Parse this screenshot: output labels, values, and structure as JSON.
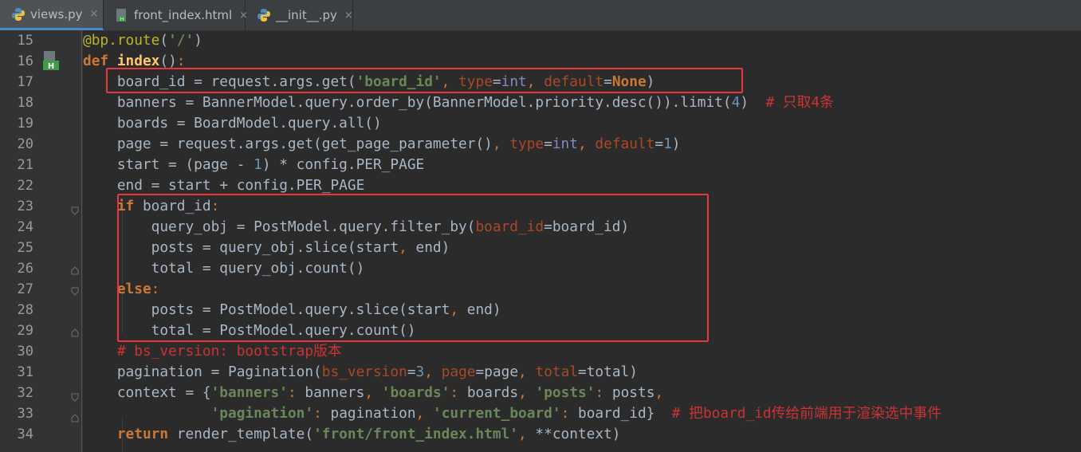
{
  "tabs": [
    {
      "label": "views.py",
      "icon": "python-file-icon",
      "active": true
    },
    {
      "label": "front_index.html",
      "icon": "html-file-icon",
      "active": false
    },
    {
      "label": "__init__.py",
      "icon": "python-file-icon",
      "active": false
    }
  ],
  "tab_close_glyph": "×",
  "highlight_color": "#e8363b",
  "line_numbers": [
    "15",
    "16",
    "17",
    "18",
    "19",
    "20",
    "21",
    "22",
    "23",
    "24",
    "25",
    "26",
    "27",
    "28",
    "29",
    "30",
    "31",
    "32",
    "33",
    "34"
  ],
  "code_lines": [
    "@bp.route('/')",
    "def index():",
    "    board_id = request.args.get('board_id', type=int, default=None)",
    "    banners = BannerModel.query.order_by(BannerModel.priority.desc()).limit(4)  # 只取4条",
    "    boards = BoardModel.query.all()",
    "    page = request.args.get(get_page_parameter(), type=int, default=1)",
    "    start = (page - 1) * config.PER_PAGE",
    "    end = start + config.PER_PAGE",
    "    if board_id:",
    "        query_obj = PostModel.query.filter_by(board_id=board_id)",
    "        posts = query_obj.slice(start, end)",
    "        total = query_obj.count()",
    "    else:",
    "        posts = PostModel.query.slice(start, end)",
    "        total = PostModel.query.count()",
    "    # bs_version: bootstrap版本",
    "    pagination = Pagination(bs_version=3, page=page, total=total)",
    "    context = {'banners': banners, 'boards': boards, 'posts': posts,",
    "               'pagination': pagination, 'current_board': board_id}  # 把board_id传给前端用于渲染选中事件",
    "    return render_template('front/front_index.html', **context)"
  ]
}
